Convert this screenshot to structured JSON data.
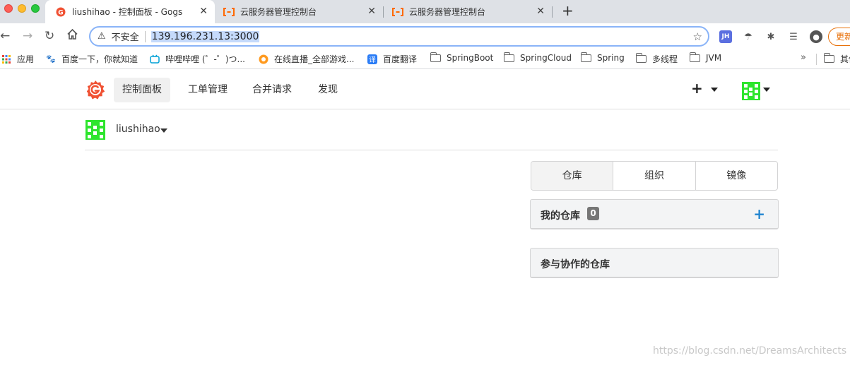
{
  "browser": {
    "tabs": [
      {
        "title": "liushihao - 控制面板 - Gogs",
        "active": true
      },
      {
        "title": "云服务器管理控制台",
        "active": false
      },
      {
        "title": "云服务器管理控制台",
        "active": false
      }
    ],
    "address": {
      "security_label": "不安全",
      "url": "139.196.231.13:3000"
    },
    "update_label": "更新",
    "bookmarks": [
      {
        "label": "应用",
        "icon": "apps-grid-icon"
      },
      {
        "label": "百度一下，你就知道",
        "icon": "baidu-paw-icon"
      },
      {
        "label": "哔哩哔哩 (゜-゜)つ...",
        "icon": "bilibili-tv-icon"
      },
      {
        "label": "在线直播_全部游戏...",
        "icon": "live-stream-icon"
      },
      {
        "label": "百度翻译",
        "icon": "translate-icon"
      },
      {
        "label": "SpringBoot",
        "icon": "folder-icon"
      },
      {
        "label": "SpringCloud",
        "icon": "folder-icon"
      },
      {
        "label": "Spring",
        "icon": "folder-icon"
      },
      {
        "label": "多线程",
        "icon": "folder-icon"
      },
      {
        "label": "JVM",
        "icon": "folder-icon"
      },
      {
        "label": "其他书签",
        "icon": "folder-icon"
      }
    ]
  },
  "header": {
    "nav": [
      {
        "label": "控制面板",
        "active": true
      },
      {
        "label": "工单管理",
        "active": false
      },
      {
        "label": "合并请求",
        "active": false
      },
      {
        "label": "发现",
        "active": false
      }
    ],
    "plus": "+"
  },
  "context": {
    "username": "liushihao"
  },
  "panel": {
    "tabs": [
      {
        "label": "仓库",
        "active": true
      },
      {
        "label": "组织",
        "active": false
      },
      {
        "label": "镜像",
        "active": false
      }
    ],
    "my_repos": {
      "title": "我的仓库",
      "count": "0",
      "add": "+"
    },
    "collab_repos": {
      "title": "参与协作的仓库"
    }
  },
  "watermark": "https://blog.csdn.net/DreamsArchitects",
  "colors": {
    "gogs_orange": "#f05133",
    "link_blue": "#2185d0",
    "avatar_green": "#2ee52e",
    "badge_gray": "#767676"
  }
}
